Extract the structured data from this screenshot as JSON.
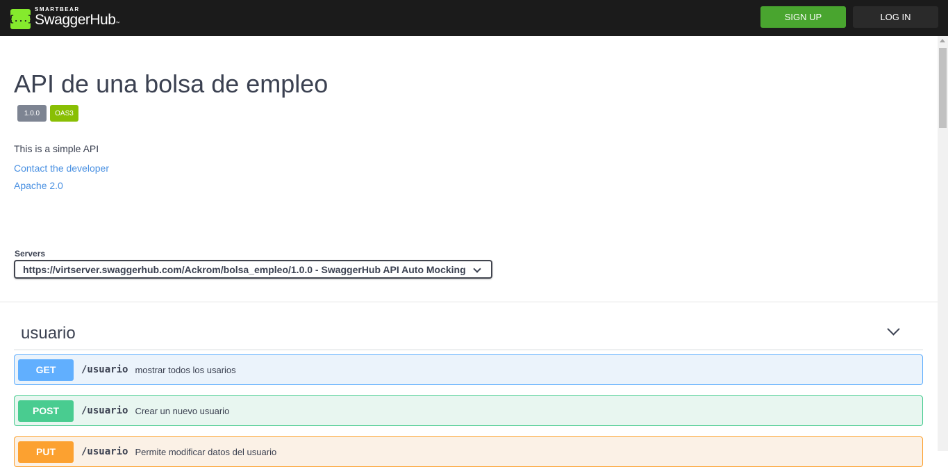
{
  "header": {
    "brand_top": "SMARTBEAR",
    "brand_name": "SwaggerHub",
    "brand_tm": "™",
    "logo_glyph": "{...}",
    "signup_label": "SIGN UP",
    "login_label": "LOG IN",
    "accent_color": "#85ea2d",
    "signup_color": "#49a52f"
  },
  "info": {
    "title": "API de una bolsa de empleo",
    "version_badge": "1.0.0",
    "oas_badge": "OAS3",
    "description": "This is a simple API",
    "contact_link": "Contact the developer",
    "license_link": "Apache 2.0"
  },
  "servers": {
    "label": "Servers",
    "selected": "https://virtserver.swaggerhub.com/Ackrom/bolsa_empleo/1.0.0 - SwaggerHub API Auto Mocking"
  },
  "tag": {
    "name": "usuario",
    "operations": [
      {
        "method": "GET",
        "path": "/usuario",
        "summary": "mostrar todos los usarios",
        "color": "#61affe"
      },
      {
        "method": "POST",
        "path": "/usuario",
        "summary": "Crear un nuevo usuario",
        "color": "#49cc90"
      },
      {
        "method": "PUT",
        "path": "/usuario",
        "summary": "Permite modificar datos del usuario",
        "color": "#fca130"
      }
    ]
  }
}
